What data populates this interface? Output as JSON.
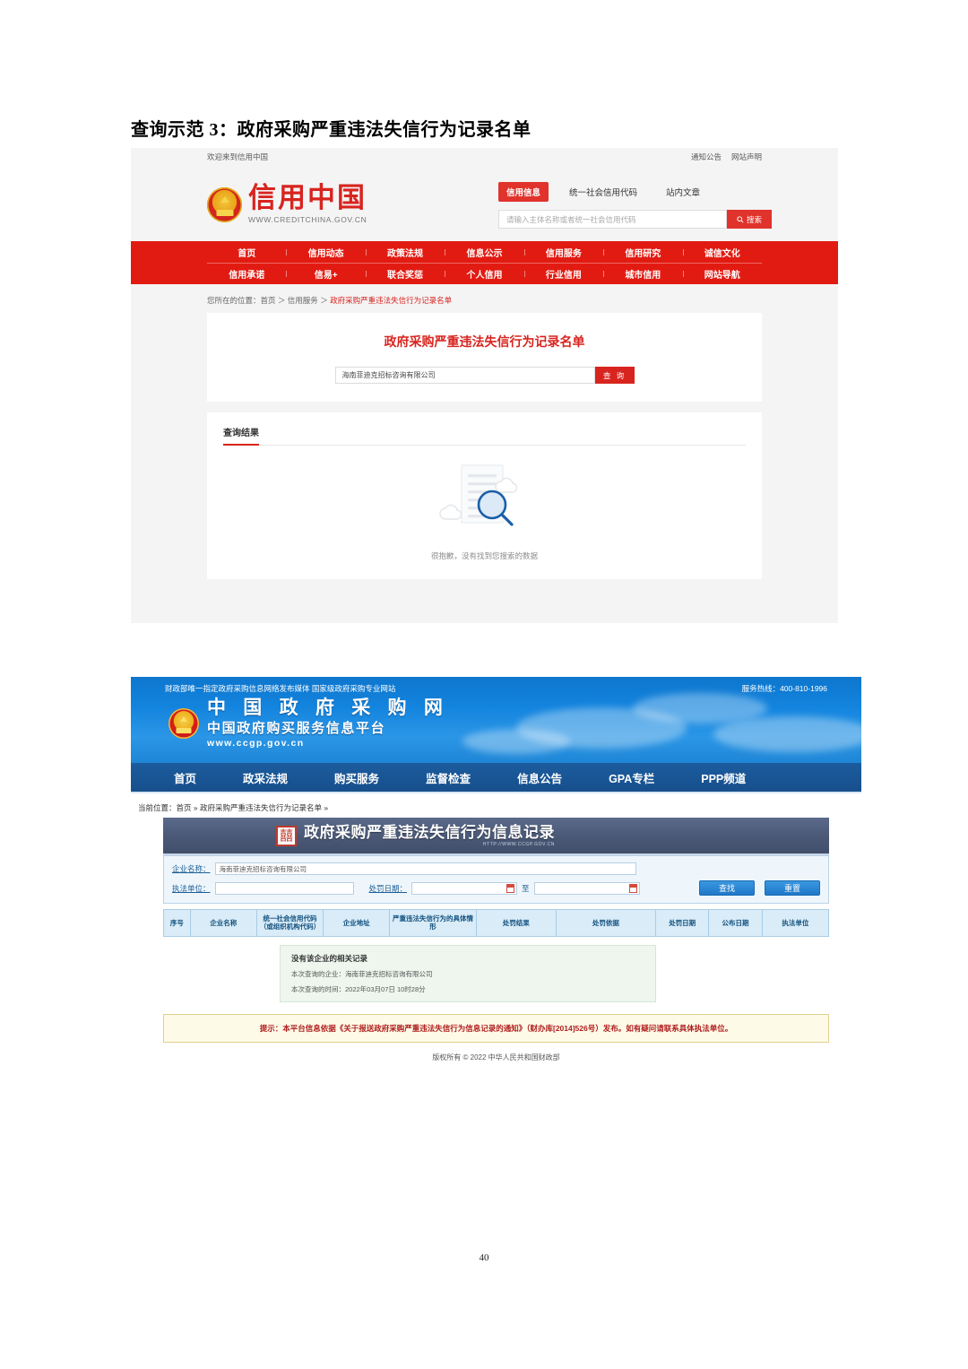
{
  "document": {
    "heading": "查询示范 3：政府采购严重违法失信行为记录名单",
    "page_number": "40"
  },
  "creditchina": {
    "topbar": {
      "welcome": "欢迎来到信用中国",
      "links": [
        "通知公告",
        "网站声明"
      ]
    },
    "logo": {
      "name": "信用中国",
      "url": "WWW.CREDITCHINA.GOV.CN",
      "emblem_icon": "national-emblem-icon"
    },
    "search": {
      "tabs": [
        "信用信息",
        "统一社会信用代码",
        "站内文章"
      ],
      "active_tab": "信用信息",
      "placeholder": "请输入主体名称或者统一社会信用代码",
      "button": "搜索",
      "search_icon": "magnifier-icon"
    },
    "nav_row1": [
      "首页",
      "信用动态",
      "政策法规",
      "信息公示",
      "信用服务",
      "信用研究",
      "诚信文化"
    ],
    "nav_row2": [
      "信用承诺",
      "信易+",
      "联合奖惩",
      "个人信用",
      "行业信用",
      "城市信用",
      "网站导航"
    ],
    "breadcrumb": {
      "prefix": "您所在的位置：",
      "items": [
        "首页",
        "信用服务"
      ],
      "current": "政府采购严重违法失信行为记录名单",
      "separator": "＞"
    },
    "panel": {
      "title": "政府采购严重违法失信行为记录名单",
      "query_value": "海南菲迪克招标咨询有限公司",
      "query_button": "查 询"
    },
    "result": {
      "header": "查询结果",
      "empty_text": "很抱歉，没有找到您搜索的数据",
      "empty_icon": "document-magnifier-icon"
    }
  },
  "ccgp": {
    "topline": {
      "slogan": "财政部唯一指定政府采购信息网络发布媒体 国家级政府采购专业网站",
      "hotline": "服务热线：400-810-1996"
    },
    "brand": {
      "line1": "中 国 政 府 采 购 网",
      "line2": "中国政府购买服务信息平台",
      "line3": "www.ccgp.gov.cn",
      "emblem_icon": "national-emblem-icon"
    },
    "nav": [
      "首页",
      "政采法规",
      "购买服务",
      "监督检查",
      "信息公告",
      "GPA专栏",
      "PPP频道"
    ],
    "breadcrumb": "当前位置：首页 » 政府采购严重违法失信行为记录名单 »",
    "banner": {
      "title": "政府采购严重违法失信行为信息记录",
      "subtitle": "HTTP://WWW.CCGP.GOV.CN",
      "icon": "seal-icon"
    },
    "form": {
      "company_label": "企业名称：",
      "company_value": "海南菲迪克招标咨询有限公司",
      "unit_label": "执法单位：",
      "unit_value": "",
      "date_label": "处罚日期：",
      "date_from": "",
      "date_to": "",
      "date_separator": "至",
      "calendar_icon": "calendar-icon",
      "search_button": "查找",
      "reset_button": "重置"
    },
    "table": {
      "headers": [
        "序号",
        "企业名称",
        "统一社会信用代码（或组织机构代码）",
        "企业地址",
        "严重违法失信行为的具体情形",
        "处罚结果",
        "处罚依据",
        "处罚日期",
        "公布日期",
        "执法单位"
      ],
      "rows": []
    },
    "empty": {
      "title": "没有该企业的相关记录",
      "line1": "本次查询的企业：海南菲迪克招标咨询有限公司",
      "line2": "本次查询的时间：2022年03月07日 10时28分"
    },
    "notice": "提示：本平台信息依据《关于报送政府采购严重违法失信行为信息记录的通知》（财办库[2014]526号）发布。如有疑问请联系具体执法单位。",
    "footer": "版权所有 © 2022 中华人民共和国财政部"
  },
  "colors": {
    "credit_red": "#e21b12",
    "ccgp_blue": "#1384de",
    "nav_blue": "#1b5c9e",
    "banner_slate": "#4a5876",
    "notice_bg": "#fdfbe8",
    "notice_text": "#b01e1e"
  }
}
